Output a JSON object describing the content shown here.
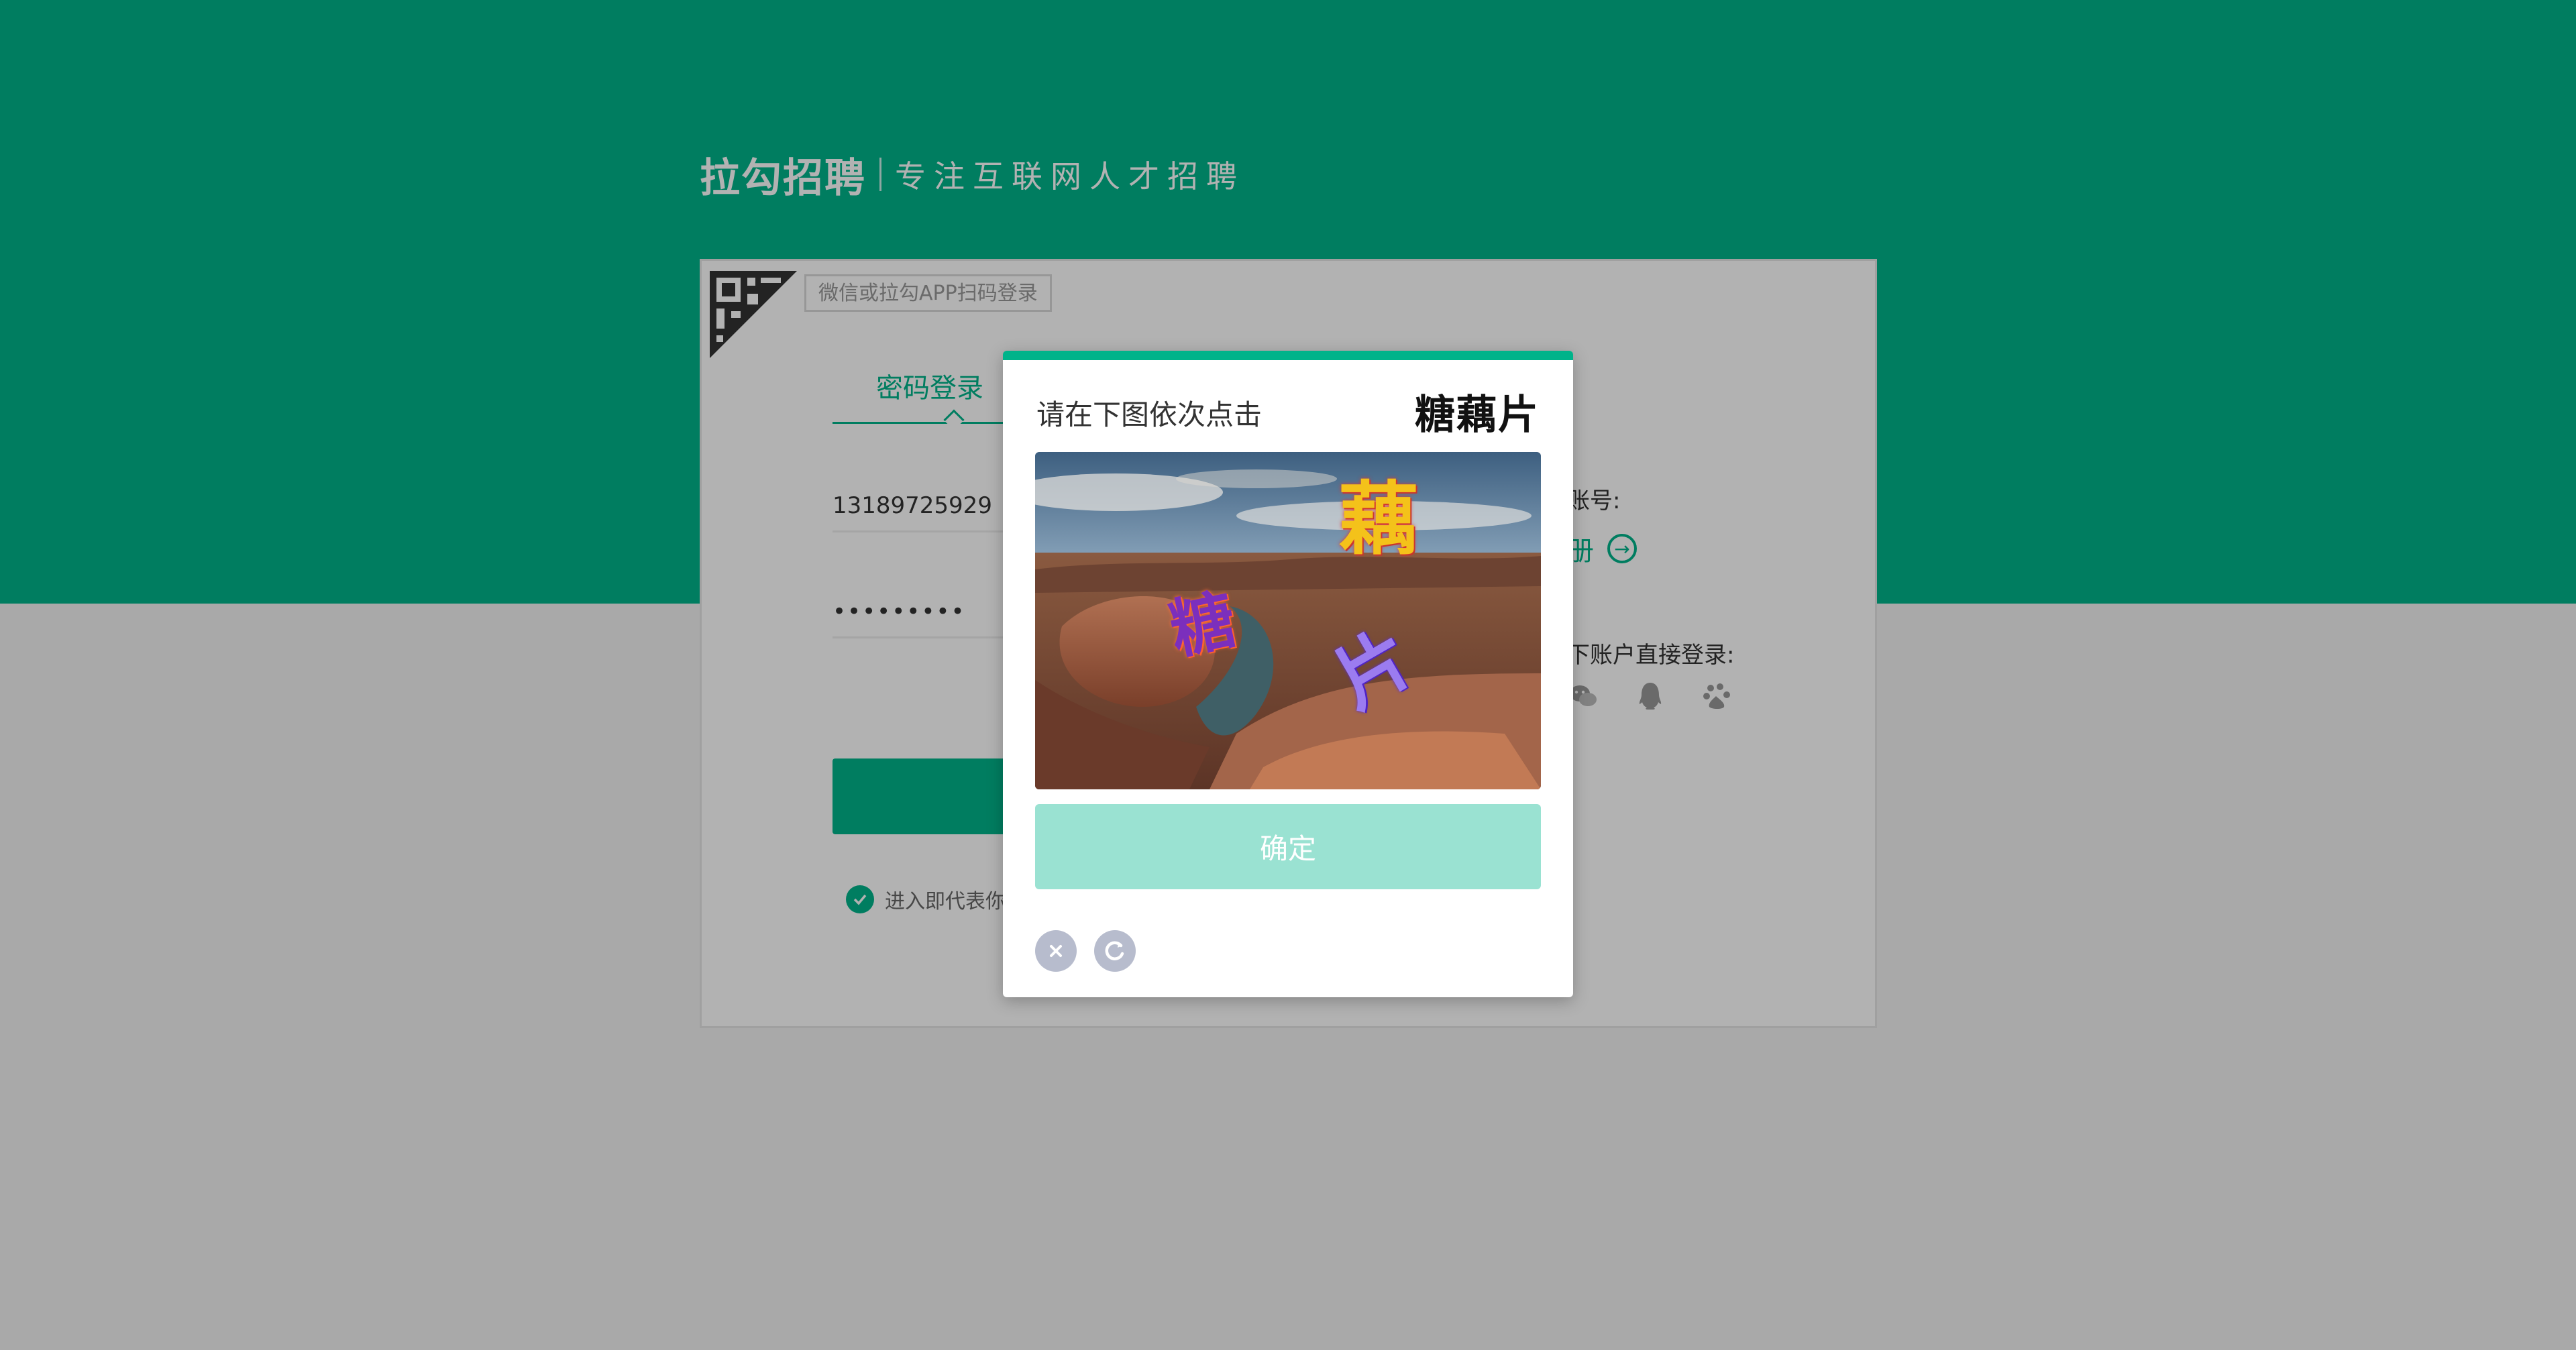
{
  "brand": {
    "logo_text": "拉勾招聘",
    "slogan": "专注互联网人才招聘"
  },
  "login_card": {
    "qr_tip": "微信或拉勾APP扫码登录",
    "tab_password": "密码登录",
    "phone_value": "13189725929",
    "password_masked": "•••••••••",
    "agree_text": "进入即代表你",
    "right_account_text": "账号:",
    "right_register_text": "册",
    "right_other_login_text": "下账户直接登录:",
    "social_icons": [
      "wechat-icon",
      "qq-icon",
      "baidu-icon"
    ]
  },
  "captcha": {
    "instruction": "请在下图依次点击",
    "target_chars": "糖藕片",
    "image_chars": [
      {
        "char": "藕",
        "name": "captcha-char-ou"
      },
      {
        "char": "糖",
        "name": "captcha-char-tang"
      },
      {
        "char": "片",
        "name": "captcha-char-pian"
      }
    ],
    "confirm_label": "确定",
    "icons": [
      "close-icon",
      "refresh-icon"
    ]
  },
  "colors": {
    "brand_green": "#00b38a",
    "confirm_disabled": "#9ae2d2",
    "captcha_icon_gray": "#b7bccd"
  }
}
